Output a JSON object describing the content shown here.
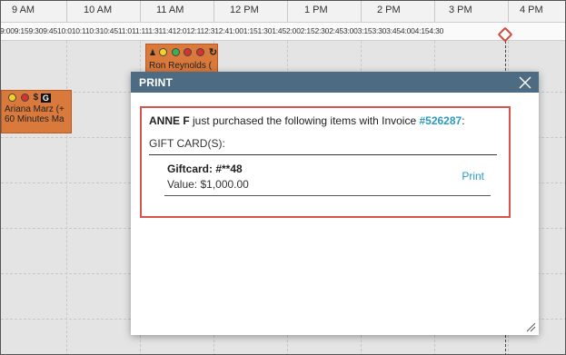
{
  "scheduler": {
    "hours": [
      "9 AM",
      "10 AM",
      "11 AM",
      "12 PM",
      "1 PM",
      "2 PM",
      "3 PM",
      "4 PM"
    ],
    "minute_strip": "9:009:159:309:4510:010:110:310:4511:011:111:311:412:012:112:312:41:001:151:301:452:002:152:302:453:003:153:303:454:004:154:30",
    "appointments": [
      {
        "label": "Ron Reynolds ("
      },
      {
        "label": "Ariana Marz (+",
        "label2": "60 Minutes Ma",
        "tag": "G"
      }
    ]
  },
  "modal": {
    "title": "PRINT",
    "message": {
      "customer": "ANNE F",
      "text": " just purchased the following items with Invoice ",
      "invoice": "#526287",
      "suffix": ":"
    },
    "section_label": "GIFT CARD(S):",
    "items": [
      {
        "name": "Giftcard: #**48",
        "value": "Value: $1,000.00",
        "action": "Print"
      }
    ]
  },
  "colors": {
    "header": "#4d6c83",
    "highlight_border": "#d9534f",
    "link": "#2a9bc1",
    "appointment": "#d9793b"
  },
  "icons": {
    "close": "close-icon",
    "resize": "resize-handle-icon",
    "now": "current-time-marker-icon"
  }
}
